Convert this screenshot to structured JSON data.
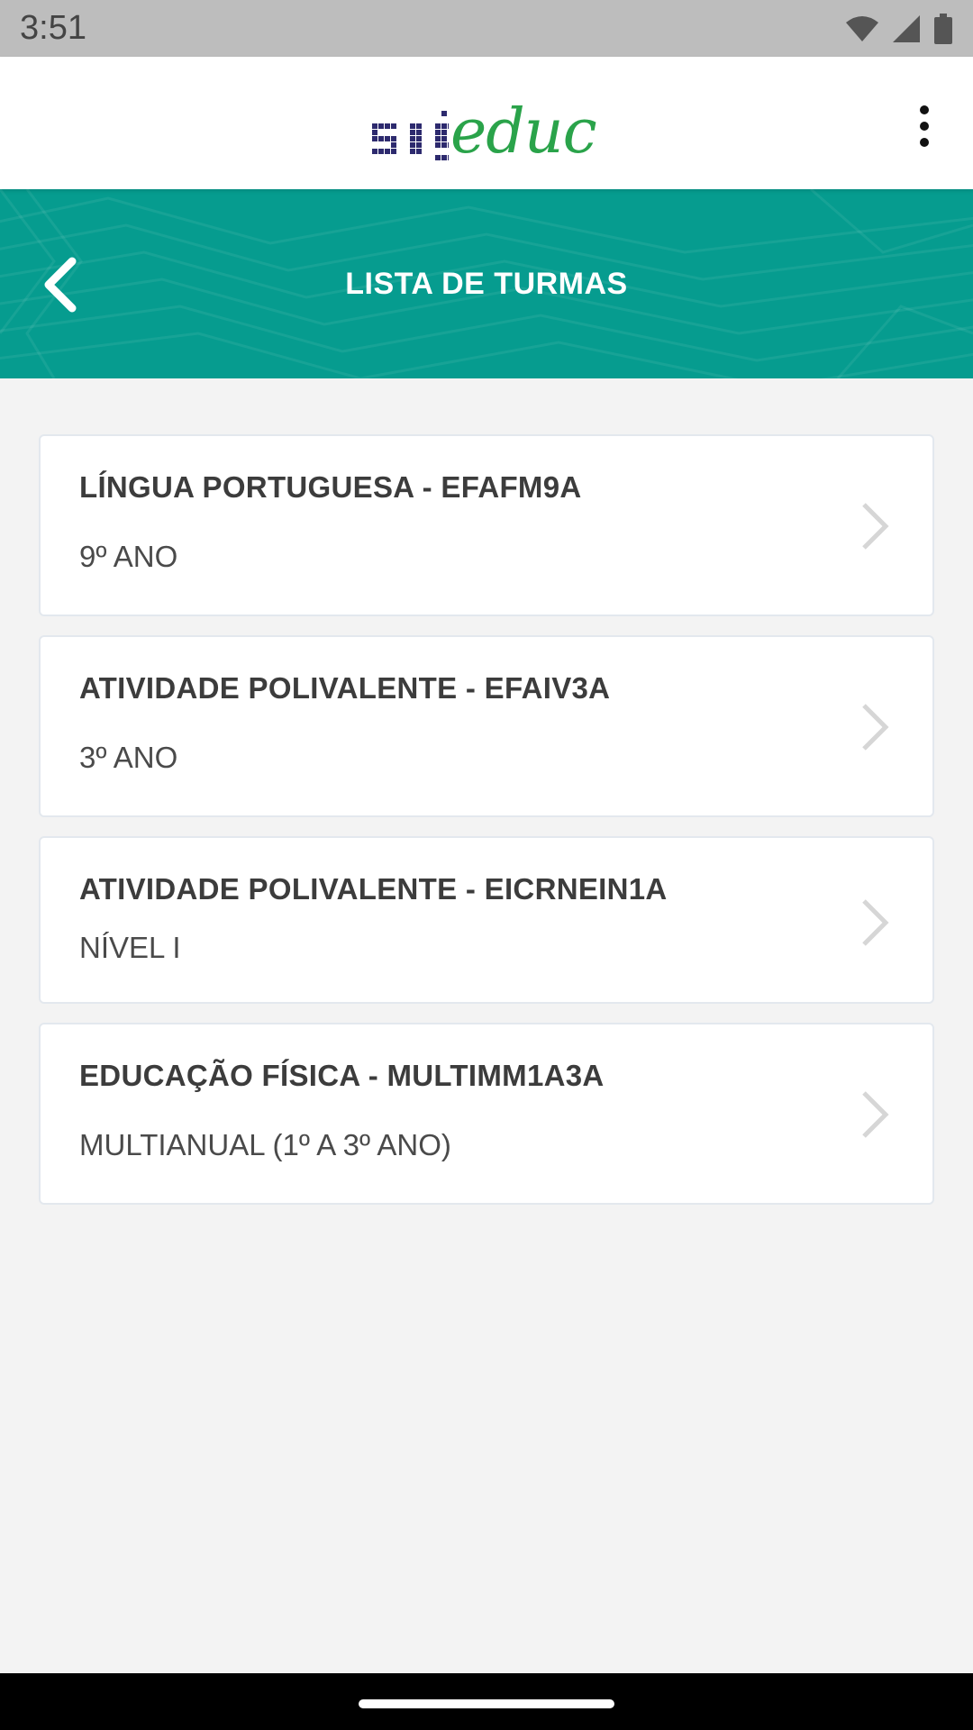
{
  "status_bar": {
    "time": "3:51",
    "icons": [
      "wifi-icon",
      "signal-icon",
      "battery-icon"
    ]
  },
  "app_bar": {
    "logo": {
      "prefix": "sig",
      "script": "educ",
      "colors": {
        "prefix": "#2d2a6e",
        "script": "#2aa34a"
      }
    },
    "menu_icon": "overflow-menu-icon"
  },
  "header": {
    "title": "LISTA DE TURMAS",
    "back_icon": "chevron-left-icon",
    "background_color": "#069c8f"
  },
  "turmas": [
    {
      "title": "LÍNGUA PORTUGUESA - EFAFM9A",
      "subtitle": "9º ANO"
    },
    {
      "title": "ATIVIDADE POLIVALENTE - EFAIV3A",
      "subtitle": "3º ANO"
    },
    {
      "title": "ATIVIDADE POLIVALENTE - EICRNEIN1A",
      "subtitle": "NÍVEL I"
    },
    {
      "title": "EDUCAÇÃO FÍSICA - MULTIMM1A3A",
      "subtitle": "MULTIANUAL (1º A 3º ANO)"
    }
  ]
}
